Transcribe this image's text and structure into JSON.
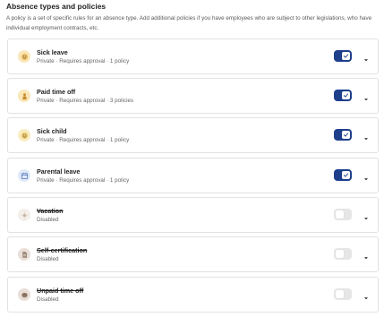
{
  "section": {
    "title": "Absence types and policies",
    "description": "A policy is a set of specific rules for an absence type. Add additional policies if you have employees who are subject to other legislations, who have individual employment contracts, etc."
  },
  "colors": {
    "accent": "#1d3f8c",
    "toggle_off": "#e6e6e6"
  },
  "absence_types": [
    {
      "name": "Sick leave",
      "meta": "Private · Requires approval · 1 policy",
      "enabled": true,
      "icon": "face-icon",
      "icon_bg": "#fbe6b8",
      "icon_fg": "#d89a25"
    },
    {
      "name": "Paid time off",
      "meta": "Private · Requires approval · 3 policies",
      "enabled": true,
      "icon": "person-icon",
      "icon_bg": "#fbe6b8",
      "icon_fg": "#c98b2a"
    },
    {
      "name": "Sick child",
      "meta": "Private · Requires approval · 1 policy",
      "enabled": true,
      "icon": "face-icon",
      "icon_bg": "#f9ecbf",
      "icon_fg": "#d3a52c"
    },
    {
      "name": "Parental leave",
      "meta": "Private · Requires approval · 1 policy",
      "enabled": true,
      "icon": "calendar-icon",
      "icon_bg": "#dfe8f8",
      "icon_fg": "#4d6fb5"
    },
    {
      "name": "Vacation",
      "meta": "Disabled",
      "enabled": false,
      "icon": "sun-icon",
      "icon_bg": "#f4efea",
      "icon_fg": "#c9b7a3"
    },
    {
      "name": "Self-certification",
      "meta": "Disabled",
      "enabled": false,
      "icon": "document-icon",
      "icon_bg": "#e9dfd8",
      "icon_fg": "#8a7060"
    },
    {
      "name": "Unpaid time off",
      "meta": "Disabled",
      "enabled": false,
      "icon": "coin-icon",
      "icon_bg": "#e9dfd8",
      "icon_fg": "#8a7060"
    }
  ]
}
